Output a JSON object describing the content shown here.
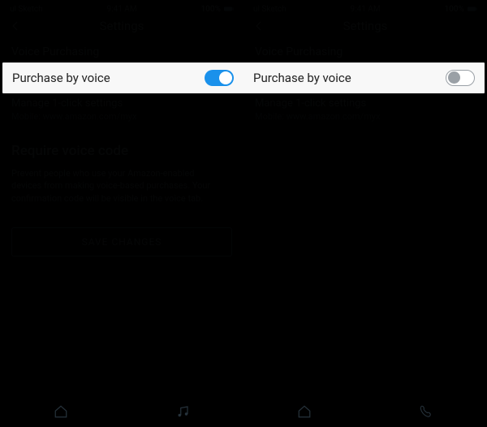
{
  "status_left": {
    "carrier": "ul Sketch"
  },
  "status_mid": {
    "time_left": "9:41 AM",
    "time_right": "9:41 AM"
  },
  "status_right": {
    "batt_left": "100%",
    "batt_right": "100%"
  },
  "nav": {
    "title": "Settings"
  },
  "voice_purchasing_header": "Voice Purchasing",
  "purchase_by_voice_label": "Purchase by voice",
  "manage_1click": "Manage 1-click settings",
  "manage_1click_sub": "Mobile: www.amazon.com/myx",
  "require_voice_code_header": "Require voice code",
  "require_voice_code_desc": "Prevent people who use your Amazon-enabled devices from making voice-based purchases. Your confirmation code will be visible in the voice tab.",
  "save_button_label": "SAVE CHANGES",
  "toggles": {
    "left_on": true,
    "right_on": false
  }
}
